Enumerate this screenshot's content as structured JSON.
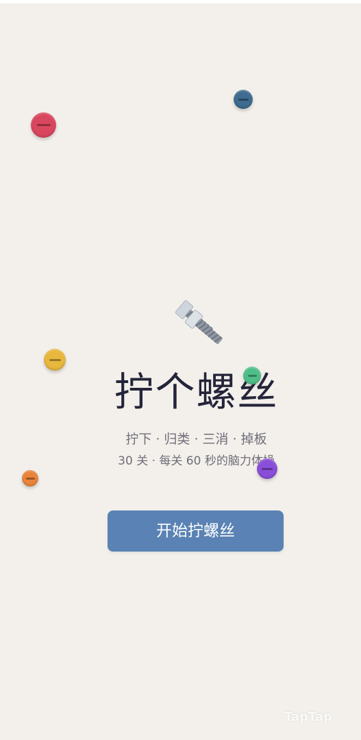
{
  "game": {
    "title": "拧个螺丝",
    "tagline": "拧下 · 归类 · 三消 · 掉板",
    "info": "30 关 · 每关 60 秒的脑力体操",
    "start_label": "开始拧螺丝",
    "hero_icon": "nut-and-bolt-icon"
  },
  "screws": [
    {
      "name": "screw-red",
      "color": "#d9475f"
    },
    {
      "name": "screw-blue",
      "color": "#3e6b8f"
    },
    {
      "name": "screw-yellow",
      "color": "#e8b73e"
    },
    {
      "name": "screw-green",
      "color": "#4fbf8a"
    },
    {
      "name": "screw-orange",
      "color": "#e9853a"
    },
    {
      "name": "screw-purple",
      "color": "#8a4fd9"
    }
  ],
  "colors": {
    "background": "#f3f0eb",
    "button": "#5a82b4",
    "title": "#24243a",
    "subtitle": "#6f6d78"
  },
  "watermark": "TapTap"
}
